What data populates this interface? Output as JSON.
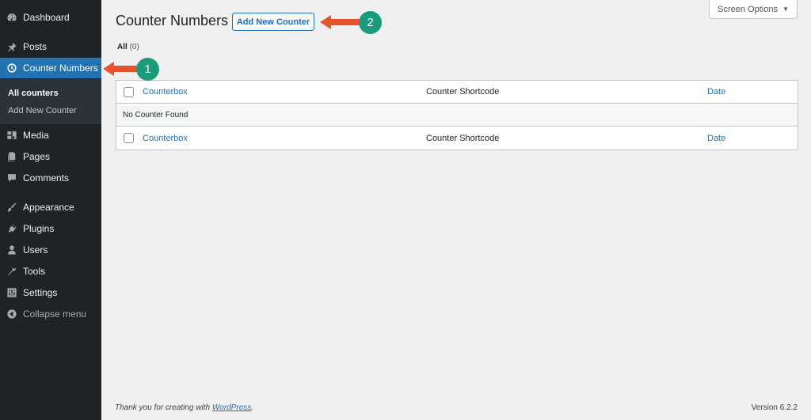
{
  "colors": {
    "sidebar_bg": "#1d2327",
    "submenu_bg": "#2c3338",
    "accent": "#2271b1",
    "annotation_arrow": "#e8522c",
    "annotation_badge": "#1a9c7c"
  },
  "sidebar": {
    "items": [
      {
        "label": "Dashboard",
        "icon": "dashboard-icon"
      },
      {
        "label": "Posts",
        "icon": "pin-icon"
      },
      {
        "label": "Counter Numbers",
        "icon": "clock-icon",
        "active": true
      },
      {
        "label": "Media",
        "icon": "media-icon"
      },
      {
        "label": "Pages",
        "icon": "pages-icon"
      },
      {
        "label": "Comments",
        "icon": "comment-icon"
      },
      {
        "label": "Appearance",
        "icon": "brush-icon"
      },
      {
        "label": "Plugins",
        "icon": "plug-icon"
      },
      {
        "label": "Users",
        "icon": "user-icon"
      },
      {
        "label": "Tools",
        "icon": "wrench-icon"
      },
      {
        "label": "Settings",
        "icon": "settings-icon"
      },
      {
        "label": "Collapse menu",
        "icon": "collapse-icon"
      }
    ],
    "submenu": [
      {
        "label": "All counters",
        "current": true
      },
      {
        "label": "Add New Counter"
      }
    ]
  },
  "header": {
    "title": "Counter Numbers",
    "add_new_label": "Add New Counter",
    "screen_options_label": "Screen Options"
  },
  "filters": {
    "all_label": "All",
    "all_count": "(0)"
  },
  "table": {
    "columns": {
      "title": "Counterbox",
      "shortcode": "Counter Shortcode",
      "date": "Date"
    },
    "empty_message": "No Counter Found"
  },
  "footer": {
    "thanks_prefix": "Thank you for creating with ",
    "thanks_link": "WordPress",
    "thanks_suffix": ".",
    "version": "Version 6.2.2"
  },
  "annotations": {
    "badge_1": "1",
    "badge_2": "2"
  }
}
